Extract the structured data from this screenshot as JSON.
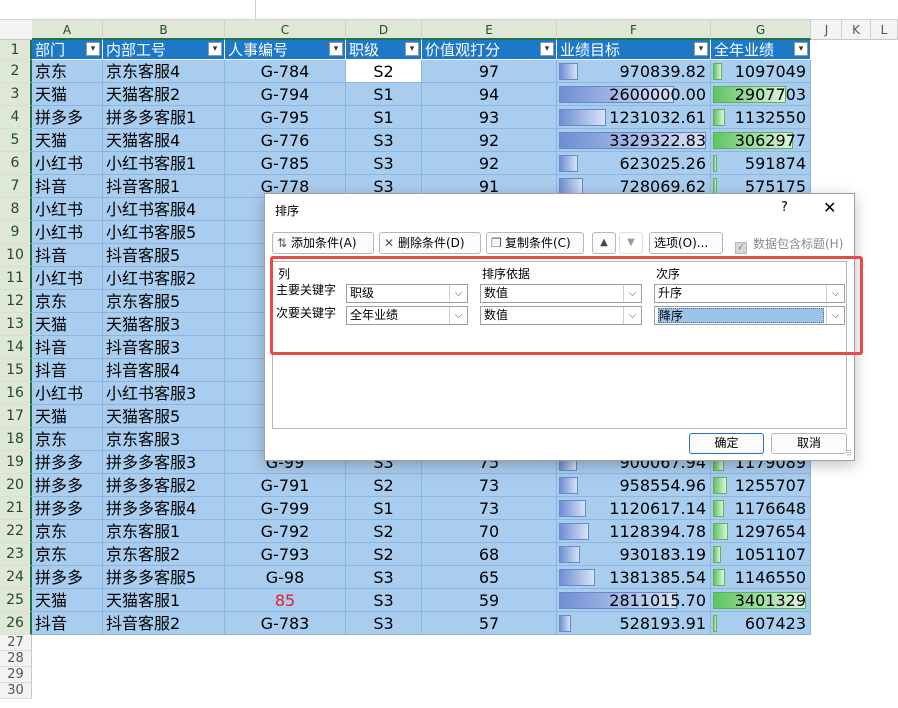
{
  "columns": [
    "A",
    "B",
    "C",
    "D",
    "E",
    "F",
    "G",
    "J",
    "K",
    "L"
  ],
  "row_numbers": [
    "1",
    "2",
    "3",
    "4",
    "5",
    "6",
    "7",
    "8",
    "9",
    "10",
    "11",
    "12",
    "13",
    "14",
    "15",
    "16",
    "17",
    "18",
    "19",
    "20",
    "21",
    "22",
    "23",
    "24",
    "25",
    "26",
    "27",
    "28",
    "29",
    "30"
  ],
  "table": {
    "headers": [
      "部门",
      "内部工号",
      "人事编号",
      "职级",
      "价值观打分",
      "业绩目标",
      "全年业绩"
    ],
    "rows": [
      {
        "dept": "京东",
        "staff": "京东客服4",
        "emp": "G-784",
        "grade": "S2",
        "score": "97",
        "target": "970839.82",
        "target_pct": 0.13,
        "total": "1097049",
        "total_pct": 0.1
      },
      {
        "dept": "天猫",
        "staff": "天猫客服2",
        "emp": "G-794",
        "grade": "S1",
        "score": "94",
        "target": "2600000.00",
        "target_pct": 0.78,
        "total": "2907703",
        "total_pct": 0.78
      },
      {
        "dept": "拼多多",
        "staff": "拼多多客服1",
        "emp": "G-795",
        "grade": "S1",
        "score": "93",
        "target": "1231032.61",
        "target_pct": 0.32,
        "total": "1132550",
        "total_pct": 0.13
      },
      {
        "dept": "天猫",
        "staff": "天猫客服4",
        "emp": "G-776",
        "grade": "S3",
        "score": "92",
        "target": "3329322.83",
        "target_pct": 0.99,
        "total": "3062977",
        "total_pct": 0.85
      },
      {
        "dept": "小红书",
        "staff": "小红书客服1",
        "emp": "G-785",
        "grade": "S3",
        "score": "92",
        "target": "623025.26",
        "target_pct": 0.13,
        "total": "591874",
        "total_pct": 0.0
      },
      {
        "dept": "抖音",
        "staff": "抖音客服1",
        "emp": "G-778",
        "grade": "S3",
        "score": "91",
        "target": "728069.62",
        "target_pct": 0.16,
        "total": "575175",
        "total_pct": 0.0
      },
      {
        "dept": "小红书",
        "staff": "小红书客服4",
        "emp": "",
        "grade": "",
        "score": "",
        "target": "",
        "target_pct": 0,
        "total": "",
        "total_pct": 0
      },
      {
        "dept": "小红书",
        "staff": "小红书客服5",
        "emp": "",
        "grade": "",
        "score": "",
        "target": "",
        "target_pct": 0,
        "total": "",
        "total_pct": 0
      },
      {
        "dept": "抖音",
        "staff": "抖音客服5",
        "emp": "",
        "grade": "",
        "score": "",
        "target": "",
        "target_pct": 0,
        "total": "",
        "total_pct": 0
      },
      {
        "dept": "小红书",
        "staff": "小红书客服2",
        "emp": "",
        "grade": "",
        "score": "",
        "target": "",
        "target_pct": 0,
        "total": "",
        "total_pct": 0
      },
      {
        "dept": "京东",
        "staff": "京东客服5",
        "emp": "",
        "grade": "",
        "score": "",
        "target": "",
        "target_pct": 0,
        "total": "",
        "total_pct": 0
      },
      {
        "dept": "天猫",
        "staff": "天猫客服3",
        "emp": "",
        "grade": "",
        "score": "",
        "target": "",
        "target_pct": 0,
        "total": "",
        "total_pct": 0
      },
      {
        "dept": "抖音",
        "staff": "抖音客服3",
        "emp": "",
        "grade": "",
        "score": "",
        "target": "",
        "target_pct": 0,
        "total": "",
        "total_pct": 0
      },
      {
        "dept": "抖音",
        "staff": "抖音客服4",
        "emp": "",
        "grade": "",
        "score": "",
        "target": "",
        "target_pct": 0,
        "total": "",
        "total_pct": 0
      },
      {
        "dept": "小红书",
        "staff": "小红书客服3",
        "emp": "",
        "grade": "",
        "score": "",
        "target": "",
        "target_pct": 0,
        "total": "",
        "total_pct": 0
      },
      {
        "dept": "天猫",
        "staff": "天猫客服5",
        "emp": "",
        "grade": "",
        "score": "",
        "target": "",
        "target_pct": 0,
        "total": "",
        "total_pct": 0
      },
      {
        "dept": "京东",
        "staff": "京东客服3",
        "emp": "",
        "grade": "",
        "score": "",
        "target": "",
        "target_pct": 0,
        "total": "",
        "total_pct": 0
      },
      {
        "dept": "拼多多",
        "staff": "拼多多客服3",
        "emp": "G-99",
        "grade": "S3",
        "score": "75",
        "target": "900067.94",
        "target_pct": 0.12,
        "total": "1179089",
        "total_pct": 0.12
      },
      {
        "dept": "拼多多",
        "staff": "拼多多客服2",
        "emp": "G-791",
        "grade": "S2",
        "score": "73",
        "target": "958554.96",
        "target_pct": 0.13,
        "total": "1255707",
        "total_pct": 0.15
      },
      {
        "dept": "拼多多",
        "staff": "拼多多客服4",
        "emp": "G-799",
        "grade": "S1",
        "score": "73",
        "target": "1120617.14",
        "target_pct": 0.18,
        "total": "1176648",
        "total_pct": 0.12
      },
      {
        "dept": "京东",
        "staff": "京东客服1",
        "emp": "G-792",
        "grade": "S2",
        "score": "70",
        "target": "1128394.78",
        "target_pct": 0.2,
        "total": "1297654",
        "total_pct": 0.16
      },
      {
        "dept": "京东",
        "staff": "京东客服2",
        "emp": "G-793",
        "grade": "S2",
        "score": "68",
        "target": "930183.19",
        "target_pct": 0.14,
        "total": "1051107",
        "total_pct": 0.09
      },
      {
        "dept": "拼多多",
        "staff": "拼多多客服5",
        "emp": "G-98",
        "grade": "S3",
        "score": "65",
        "target": "1381385.54",
        "target_pct": 0.24,
        "total": "1146550",
        "total_pct": 0.13
      },
      {
        "dept": "天猫",
        "staff": "天猫客服1",
        "emp": "85",
        "grade": "S3",
        "score": "59",
        "target": "2811015.70",
        "target_pct": 0.8,
        "total": "3401329",
        "total_pct": 0.99
      },
      {
        "dept": "抖音",
        "staff": "抖音客服2",
        "emp": "G-783",
        "grade": "S3",
        "score": "57",
        "target": "528193.91",
        "target_pct": 0.08,
        "total": "607423",
        "total_pct": 0.0
      }
    ]
  },
  "dialog": {
    "title": "排序",
    "help": "?",
    "close": "✕",
    "toolbar": {
      "add_condition": "添加条件(A)",
      "delete_condition": "删除条件(D)",
      "copy_condition": "复制条件(C)",
      "move_up": "▲",
      "move_down": "▼",
      "options": "选项(O)...",
      "has_header_label": "数据包含标题(H)"
    },
    "list_headers": {
      "column": "列",
      "sort_on": "排序依据",
      "order": "次序"
    },
    "rows": [
      {
        "label": "主要关键字",
        "column": "职级",
        "sort_on": "数值",
        "order": "升序"
      },
      {
        "label": "次要关键字",
        "column": "全年业绩",
        "sort_on": "数值",
        "order": "降序"
      }
    ],
    "ok": "确定",
    "cancel": "取消"
  },
  "colors": {
    "header_blue": "#1e78c8",
    "cell_blue": "#a9cdee",
    "highlight_red": "#e84a4a",
    "ok_border": "#2d6fc2"
  }
}
